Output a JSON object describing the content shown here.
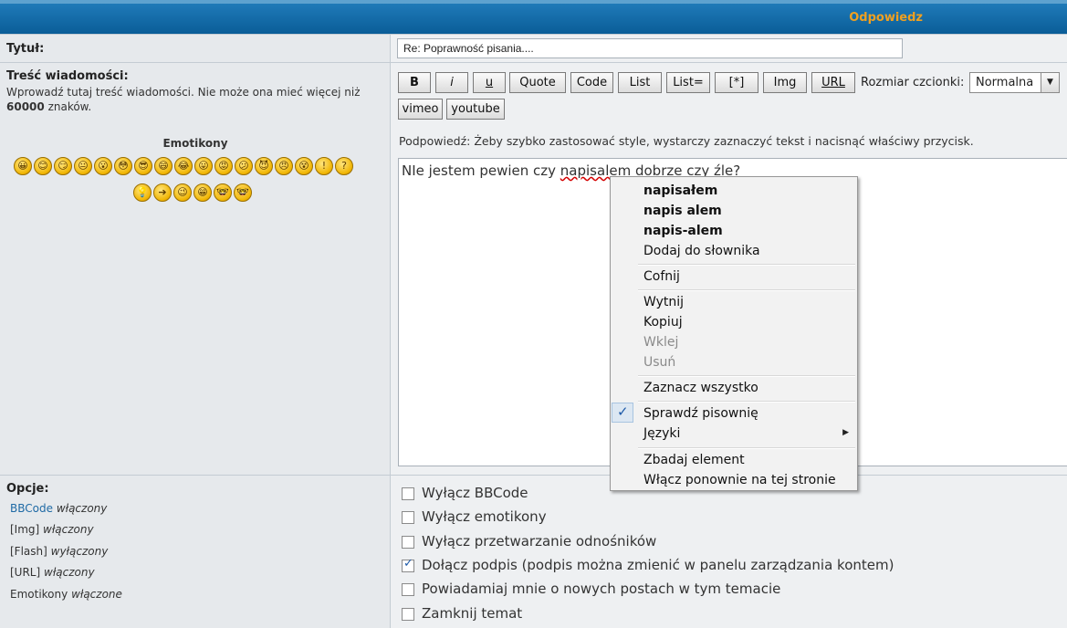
{
  "header": {
    "title": "Odpowiedz"
  },
  "title_row": {
    "label": "Tytuł:",
    "value": "Re: Poprawność pisania...."
  },
  "message_row": {
    "label": "Treść wiadomości:",
    "desc_line1": "Wprowadź tutaj treść wiadomości. Nie może ona mieć więcej niż",
    "desc_count": "60000",
    "desc_suffix": " znaków.",
    "emoticons_label": "Emotikony",
    "emoticons_row1": [
      "😀",
      "😊",
      "😏",
      "😐",
      "😮",
      "😳",
      "😎",
      "😄",
      "😂",
      "😛",
      "😡",
      "😕",
      "😈",
      "😠",
      "😵",
      "!",
      "?"
    ],
    "emoticons_row2": [
      "💡",
      "➔",
      "😉",
      "😁",
      "🤓",
      "🤓"
    ]
  },
  "toolbar": {
    "buttons": [
      "B",
      "i",
      "u",
      "Quote",
      "Code",
      "List",
      "List=",
      "[*]",
      "Img",
      "URL"
    ],
    "font_size_label": "Rozmiar czcionki:",
    "font_size_value": "Normalna",
    "buttons_row2": [
      "vimeo",
      "youtube"
    ],
    "hint": "Podpowiedź: Żeby szybko zastosować style, wystarczy zaznaczyć tekst i nacisnąć właściwy przycisk."
  },
  "editor": {
    "text_before": "NIe jestem pewien czy ",
    "misspelled": "napisalem",
    "text_after": " dobrze czy źle?"
  },
  "context_menu": {
    "suggestions": [
      "napisałem",
      "napis alem",
      "napis-alem"
    ],
    "add_to_dictionary": "Dodaj do słownika",
    "undo": "Cofnij",
    "cut": "Wytnij",
    "copy": "Kopiuj",
    "paste": "Wklej",
    "delete": "Usuń",
    "select_all": "Zaznacz wszystko",
    "spellcheck": "Sprawdź pisownię",
    "languages": "Języki",
    "inspect": "Zbadaj element",
    "reenable": "Włącz ponownie na tej stronie"
  },
  "options": {
    "label": "Opcje:",
    "statuses": [
      {
        "name": "BBCode",
        "state": "włączony",
        "link": true
      },
      {
        "name": "[Img]",
        "state": "włączony",
        "link": false
      },
      {
        "name": "[Flash]",
        "state": "wyłączony",
        "link": false
      },
      {
        "name": "[URL]",
        "state": "włączony",
        "link": false
      },
      {
        "name": "Emotikony",
        "state": "włączone",
        "link": false
      }
    ],
    "checkboxes": [
      {
        "label": "Wyłącz BBCode",
        "checked": false
      },
      {
        "label": "Wyłącz emotikony",
        "checked": false
      },
      {
        "label": "Wyłącz przetwarzanie odnośników",
        "checked": false
      },
      {
        "label": "Dołącz podpis (podpis można zmienić w panelu zarządzania kontem)",
        "checked": true
      },
      {
        "label": "Powiadamiaj mnie o nowych postach w tym temacie",
        "checked": false
      },
      {
        "label": "Zamknij temat",
        "checked": false
      }
    ]
  },
  "colors": {
    "header": "#0a5d98",
    "accent": "#f0a020",
    "link": "#1f6aa5"
  }
}
